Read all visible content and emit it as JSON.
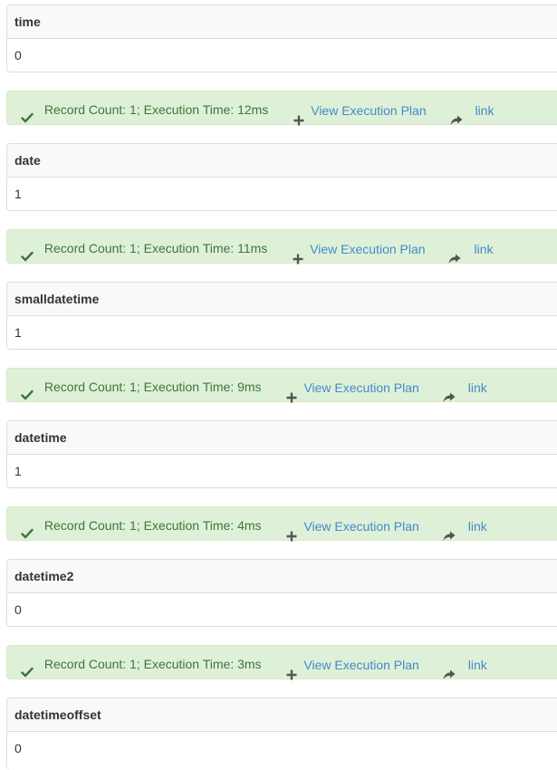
{
  "results": [
    {
      "column": "time",
      "value": "0",
      "status": "Record Count: 1; Execution Time: 12ms",
      "plan_label": "View Execution Plan",
      "link_label": "link"
    },
    {
      "column": "date",
      "value": "1",
      "status": "Record Count: 1; Execution Time: 11ms",
      "plan_label": "View Execution Plan",
      "link_label": "link"
    },
    {
      "column": "smalldatetime",
      "value": "1",
      "status": "Record Count: 1; Execution Time: 9ms",
      "plan_label": "View Execution Plan",
      "link_label": "link"
    },
    {
      "column": "datetime",
      "value": "1",
      "status": "Record Count: 1; Execution Time: 4ms",
      "plan_label": "View Execution Plan",
      "link_label": "link"
    },
    {
      "column": "datetime2",
      "value": "0",
      "status": "Record Count: 1; Execution Time: 3ms",
      "plan_label": "View Execution Plan",
      "link_label": "link"
    },
    {
      "column": "datetimeoffset",
      "value": "0"
    }
  ],
  "icons": {
    "status": "checkmark-icon",
    "plan": "plus-icon",
    "link": "share-icon"
  },
  "colors": {
    "success_bg": "#dff0d8",
    "success_text": "#3c763d",
    "link": "#428bca",
    "header_bg": "#f9f9f9",
    "border": "#dddddd"
  }
}
